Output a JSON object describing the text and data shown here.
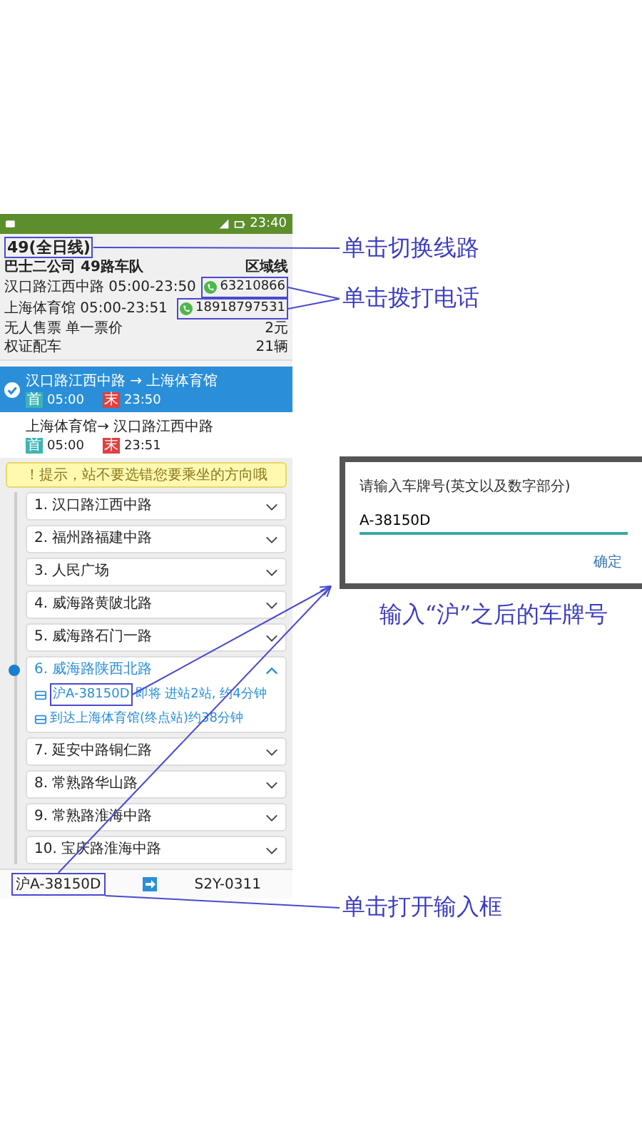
{
  "status_bar": {
    "time": "23:40"
  },
  "route": {
    "name": "49(全日线)",
    "company": "巴士二公司 49路车队",
    "type": "区域线"
  },
  "terminals": [
    {
      "name": "汉口路江西中路",
      "hours": "05:00-23:50",
      "phone": "63210866"
    },
    {
      "name": "上海体育馆",
      "hours": "05:00-23:51",
      "phone": "18918797531"
    }
  ],
  "facts": [
    {
      "label": "无人售票 单一票价",
      "value": "2元"
    },
    {
      "label": "权证配车",
      "value": "21辆"
    }
  ],
  "directions": [
    {
      "title": "汉口路江西中路 → 上海体育馆",
      "first_tag": "首",
      "first": "05:00",
      "last_tag": "末",
      "last": "23:50",
      "selected": true
    },
    {
      "title": "上海体育馆→ 汉口路江西中路",
      "first_tag": "首",
      "first": "05:00",
      "last_tag": "末",
      "last": "23:51",
      "selected": false
    }
  ],
  "notice": "！提示，站不要选错您要乘坐的方向哦",
  "stops": [
    {
      "label": "1. 汉口路江西中路",
      "expanded": false,
      "current": false
    },
    {
      "label": "2. 福州路福建中路",
      "expanded": false,
      "current": false
    },
    {
      "label": "3. 人民广场",
      "expanded": false,
      "current": false
    },
    {
      "label": "4. 威海路黄陂北路",
      "expanded": false,
      "current": false
    },
    {
      "label": "5. 威海路石门一路",
      "expanded": false,
      "current": false
    },
    {
      "label": "6. 威海路陕西北路",
      "expanded": true,
      "current": true,
      "details": [
        {
          "plate": "沪A-38150D",
          "text": "即将 进站2站, 约4分钟"
        },
        {
          "text": "到达上海体育馆(终点站)约38分钟"
        }
      ]
    },
    {
      "label": "7. 延安中路铜仁路",
      "expanded": false,
      "current": false
    },
    {
      "label": "8. 常熟路华山路",
      "expanded": false,
      "current": false
    },
    {
      "label": "9. 常熟路淮海中路",
      "expanded": false,
      "current": false
    },
    {
      "label": "10. 宝庆路淮海中路",
      "expanded": false,
      "current": false
    }
  ],
  "bottom_bar": {
    "plate": "沪A-38150D",
    "bus_no": "S2Y-0311"
  },
  "dialog": {
    "title": "请输入车牌号(英文以及数字部分)",
    "value": "A-38150D",
    "button": "确定"
  },
  "callouts": [
    {
      "text": "单击切换线路",
      "kind": "route"
    },
    {
      "text": "单击拨打电话",
      "kind": "phones"
    },
    {
      "text": "输入“沪”之后的车牌号",
      "kind": "dialog"
    },
    {
      "text": "单击打开输入框",
      "kind": "plate"
    }
  ]
}
